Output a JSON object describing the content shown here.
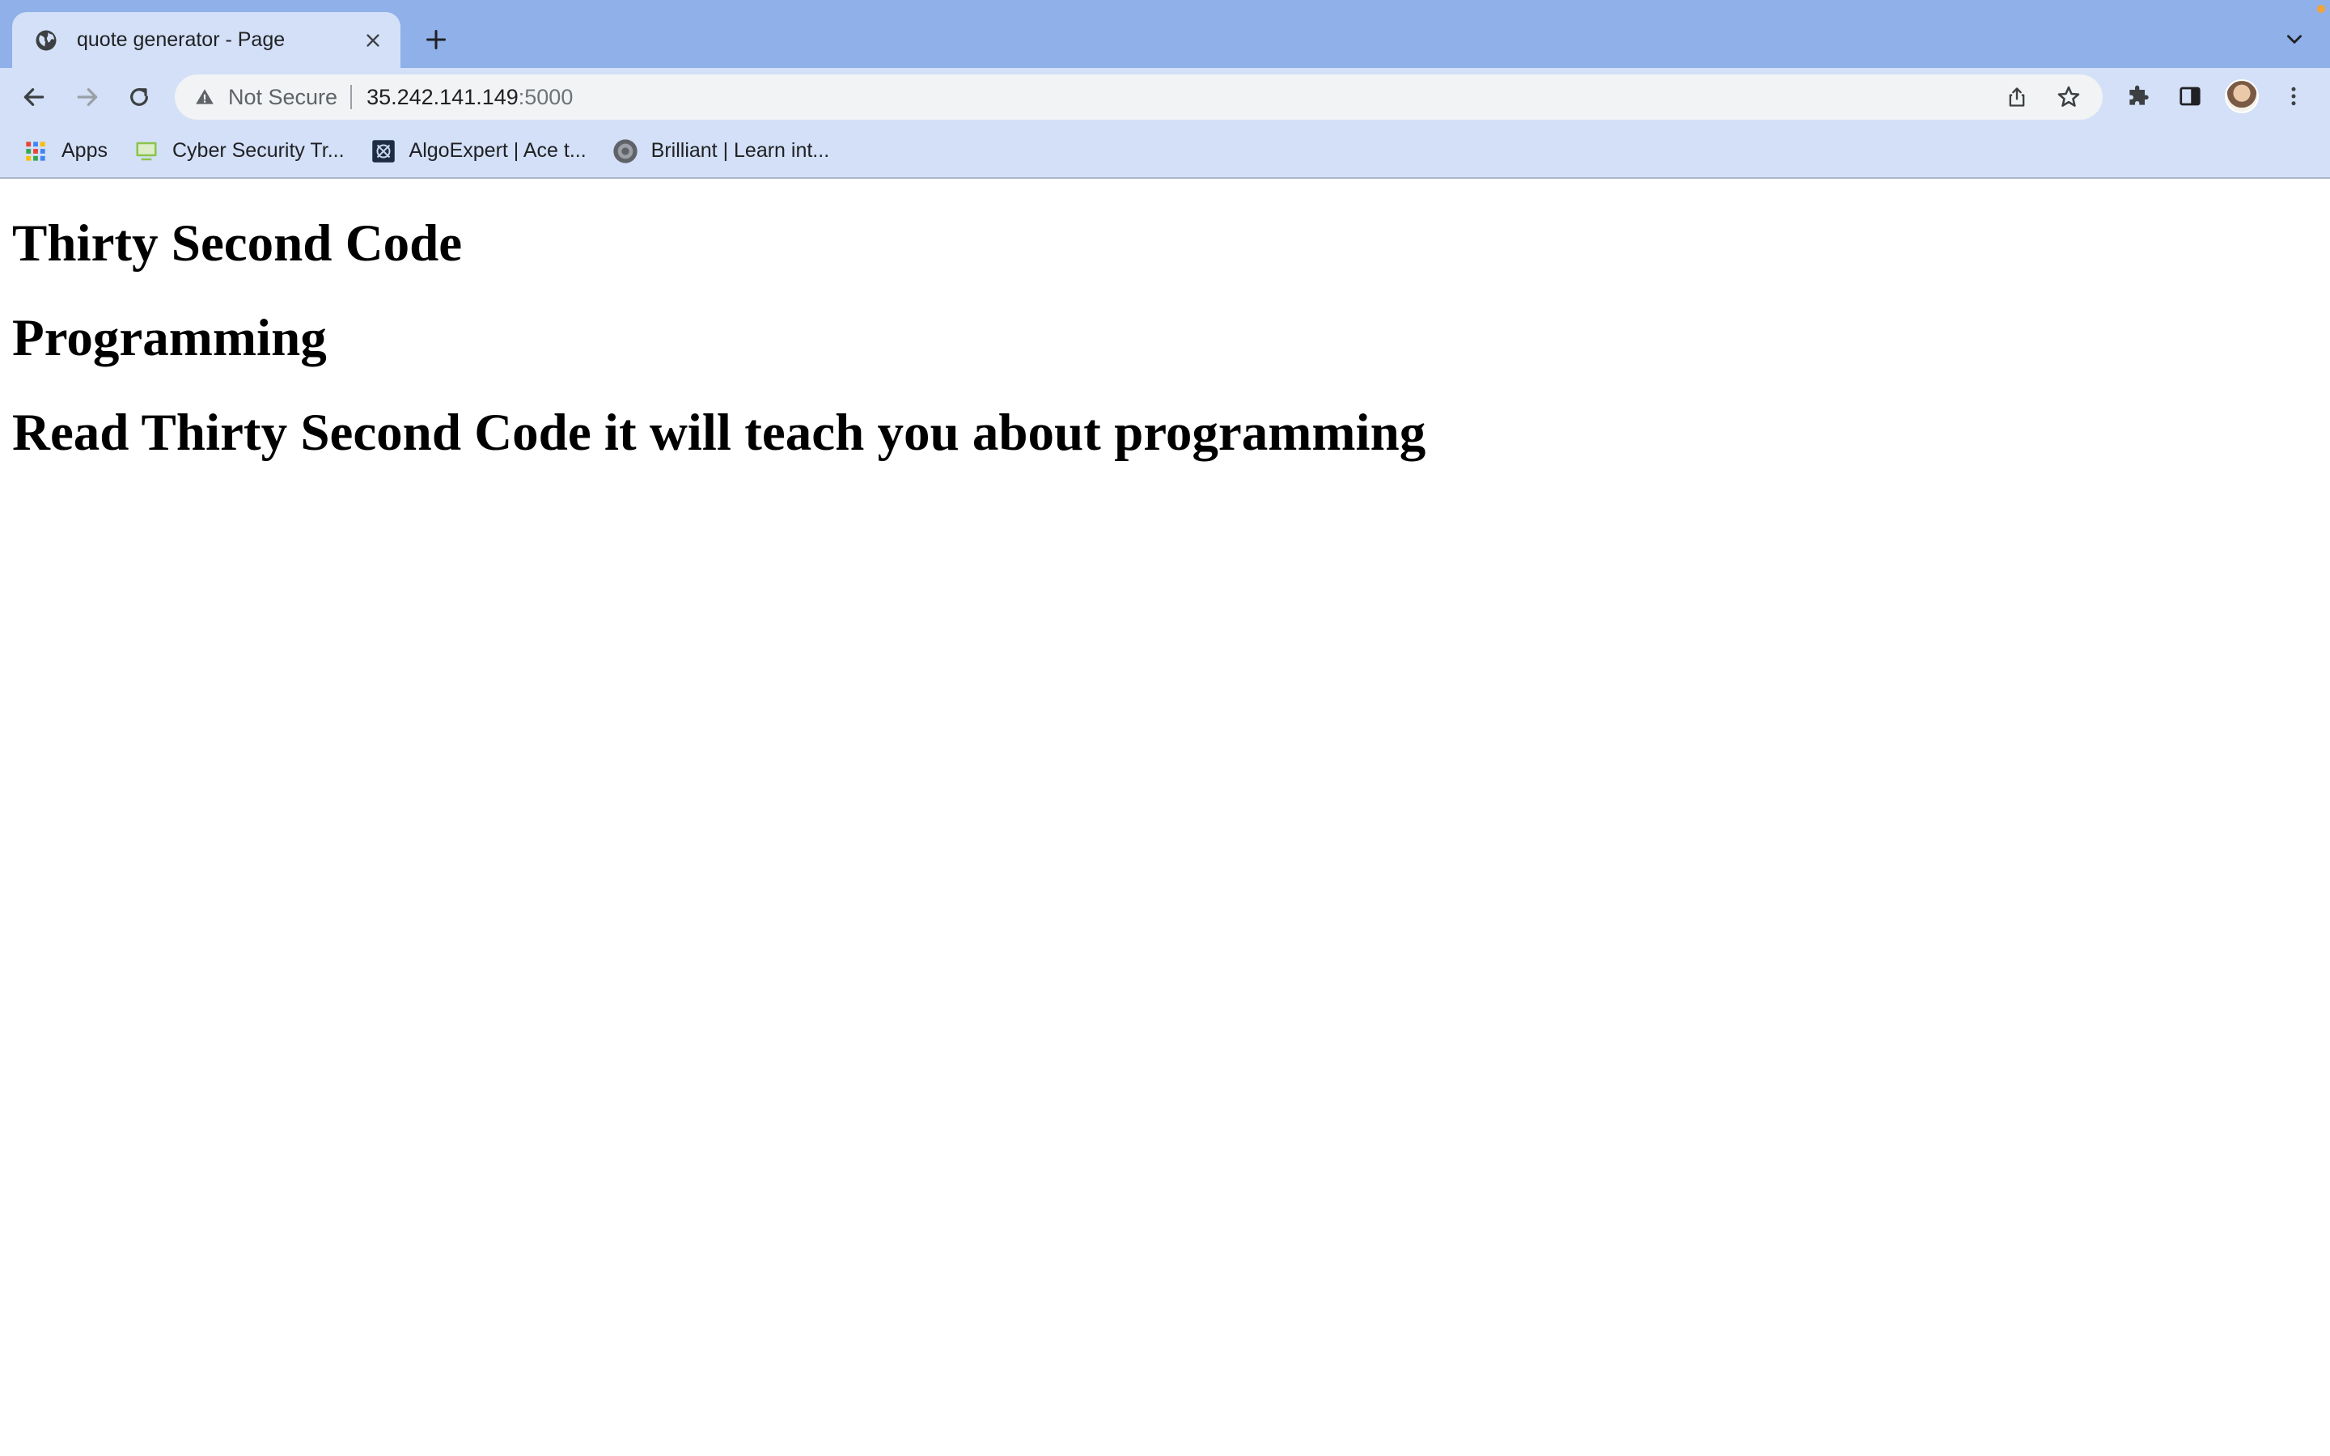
{
  "browser": {
    "tab": {
      "title": "quote generator - Page"
    },
    "address_bar": {
      "security_label": "Not Secure",
      "host": "35.242.141.149",
      "port": ":5000"
    },
    "bookmarks": [
      {
        "label": "Apps",
        "icon": "apps-grid-icon"
      },
      {
        "label": "Cyber Security Tr...",
        "icon": "monitor-icon"
      },
      {
        "label": "AlgoExpert | Ace t...",
        "icon": "algoexpert-icon"
      },
      {
        "label": "Brilliant | Learn int...",
        "icon": "brilliant-icon"
      }
    ],
    "colors": {
      "tabstrip": "#8fb0e8",
      "toolbar": "#d3e0f7",
      "omnibox": "#f1f3f4"
    }
  },
  "page": {
    "heading1": "Thirty Second Code",
    "heading2": "Programming",
    "heading3": "Read Thirty Second Code it will teach you about programming"
  }
}
